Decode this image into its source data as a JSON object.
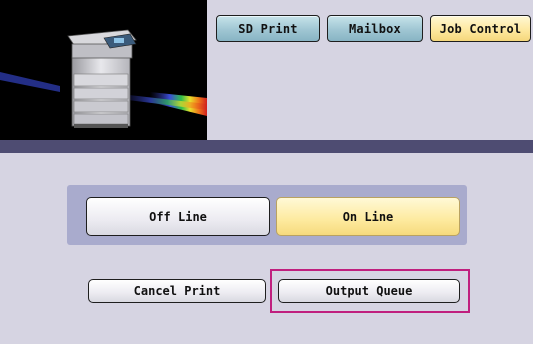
{
  "tabs": [
    {
      "label": "SD Print",
      "active": false
    },
    {
      "label": "Mailbox",
      "active": false
    },
    {
      "label": "Job Control",
      "active": true
    }
  ],
  "line_status": {
    "off_line_label": "Off Line",
    "on_line_label": "On Line",
    "selected": "On Line"
  },
  "actions": {
    "cancel_print_label": "Cancel Print",
    "output_queue_label": "Output Queue"
  },
  "colors": {
    "background": "#d6d4e2",
    "divider_band": "#4e4c72",
    "inactive_tab": "#9fc6d3",
    "active_tab": "#fde79c",
    "highlight": "#c01f7e"
  },
  "icons": {
    "printer_image": "multifunction-printer-image"
  }
}
